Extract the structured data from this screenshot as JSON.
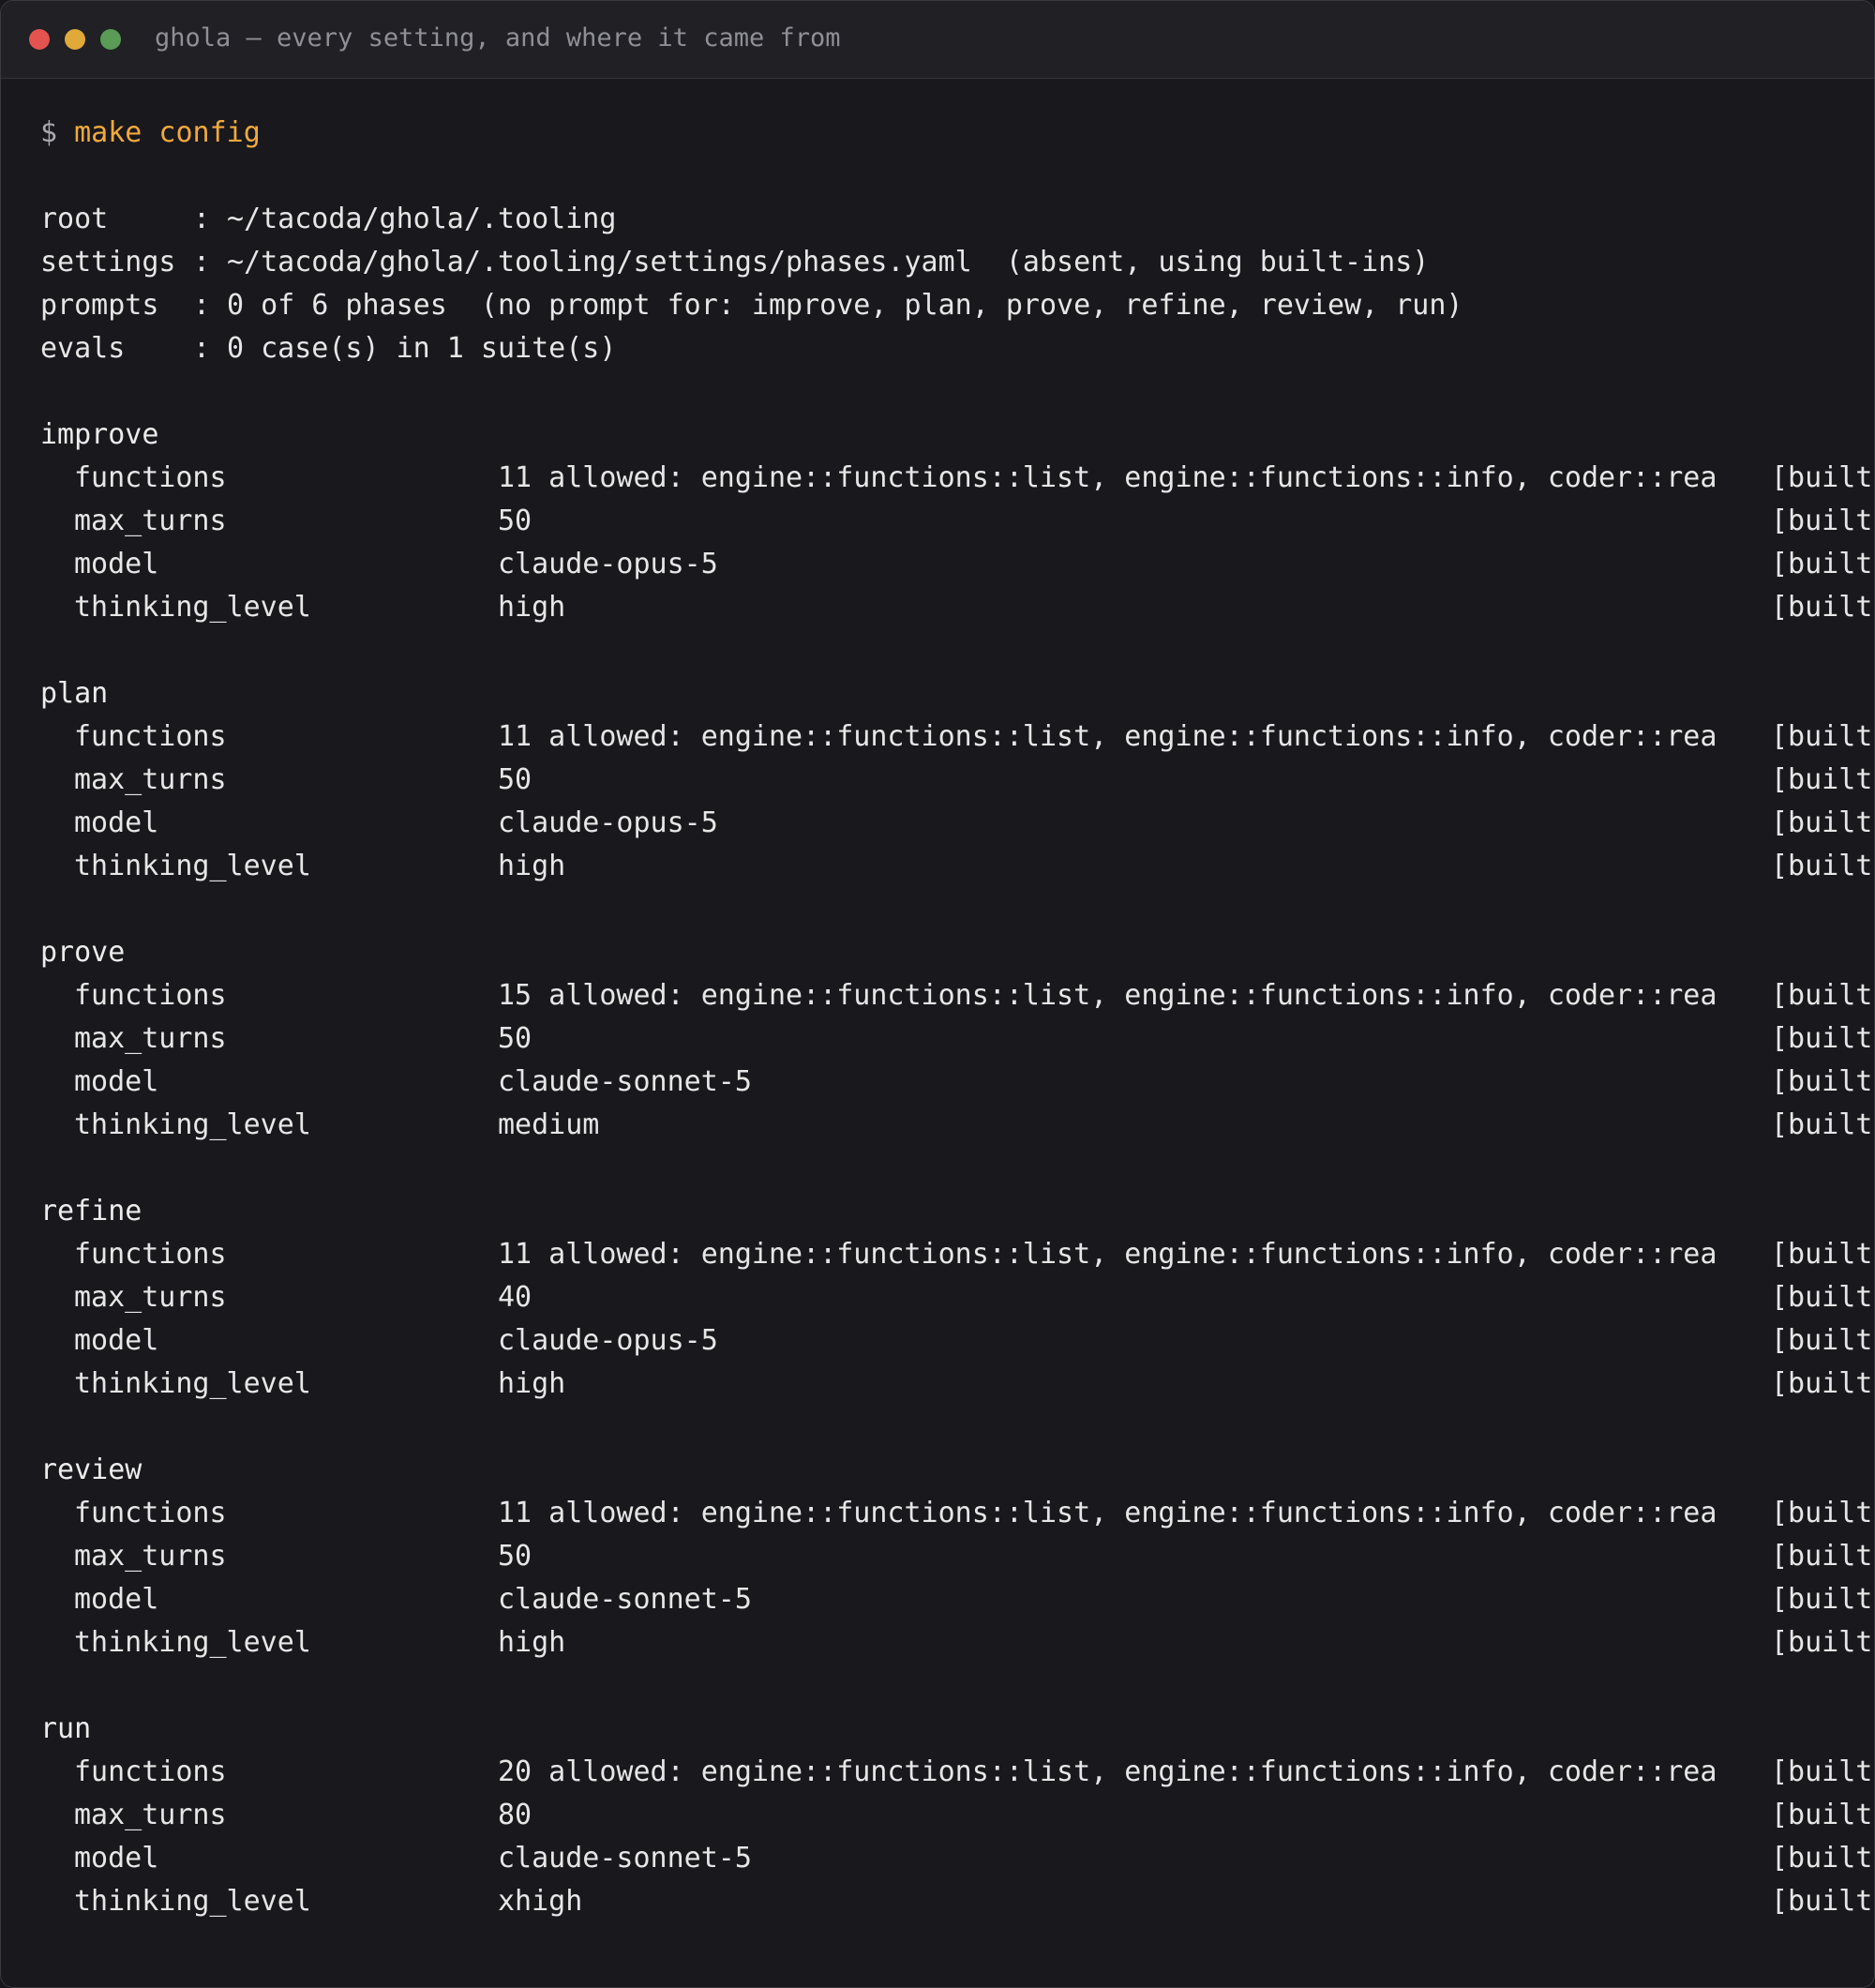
{
  "window": {
    "title": "ghola — every setting, and where it came from"
  },
  "terminal": {
    "prompt": "$",
    "command": "make config",
    "meta": [
      {
        "key": "root",
        "sep": ":",
        "value": "~/tacoda/ghola/.tooling"
      },
      {
        "key": "settings",
        "sep": ":",
        "value": "~/tacoda/ghola/.tooling/settings/phases.yaml  (absent, using built-ins)"
      },
      {
        "key": "prompts",
        "sep": ":",
        "value": "0 of 6 phases  (no prompt for: improve, plan, prove, refine, review, run)"
      },
      {
        "key": "evals",
        "sep": ":",
        "value": "0 case(s) in 1 suite(s)"
      }
    ],
    "phases": [
      {
        "name": "improve",
        "rows": [
          {
            "key": "functions",
            "value": "11 allowed: engine::functions::list, engine::functions::info, coder::rea",
            "source": "[built-"
          },
          {
            "key": "max_turns",
            "value": "50",
            "source": "[built-"
          },
          {
            "key": "model",
            "value": "claude-opus-5",
            "source": "[built-"
          },
          {
            "key": "thinking_level",
            "value": "high",
            "source": "[built-"
          }
        ]
      },
      {
        "name": "plan",
        "rows": [
          {
            "key": "functions",
            "value": "11 allowed: engine::functions::list, engine::functions::info, coder::rea",
            "source": "[built-"
          },
          {
            "key": "max_turns",
            "value": "50",
            "source": "[built-"
          },
          {
            "key": "model",
            "value": "claude-opus-5",
            "source": "[built-"
          },
          {
            "key": "thinking_level",
            "value": "high",
            "source": "[built-"
          }
        ]
      },
      {
        "name": "prove",
        "rows": [
          {
            "key": "functions",
            "value": "15 allowed: engine::functions::list, engine::functions::info, coder::rea",
            "source": "[built-"
          },
          {
            "key": "max_turns",
            "value": "50",
            "source": "[built-"
          },
          {
            "key": "model",
            "value": "claude-sonnet-5",
            "source": "[built-"
          },
          {
            "key": "thinking_level",
            "value": "medium",
            "source": "[built-"
          }
        ]
      },
      {
        "name": "refine",
        "rows": [
          {
            "key": "functions",
            "value": "11 allowed: engine::functions::list, engine::functions::info, coder::rea",
            "source": "[built-"
          },
          {
            "key": "max_turns",
            "value": "40",
            "source": "[built-"
          },
          {
            "key": "model",
            "value": "claude-opus-5",
            "source": "[built-"
          },
          {
            "key": "thinking_level",
            "value": "high",
            "source": "[built-"
          }
        ]
      },
      {
        "name": "review",
        "rows": [
          {
            "key": "functions",
            "value": "11 allowed: engine::functions::list, engine::functions::info, coder::rea",
            "source": "[built-"
          },
          {
            "key": "max_turns",
            "value": "50",
            "source": "[built-"
          },
          {
            "key": "model",
            "value": "claude-sonnet-5",
            "source": "[built-"
          },
          {
            "key": "thinking_level",
            "value": "high",
            "source": "[built-"
          }
        ]
      },
      {
        "name": "run",
        "rows": [
          {
            "key": "functions",
            "value": "20 allowed: engine::functions::list, engine::functions::info, coder::rea",
            "source": "[built-"
          },
          {
            "key": "max_turns",
            "value": "80",
            "source": "[built-"
          },
          {
            "key": "model",
            "value": "claude-sonnet-5",
            "source": "[built-"
          },
          {
            "key": "thinking_level",
            "value": "xhigh",
            "source": "[built-"
          }
        ]
      }
    ]
  }
}
